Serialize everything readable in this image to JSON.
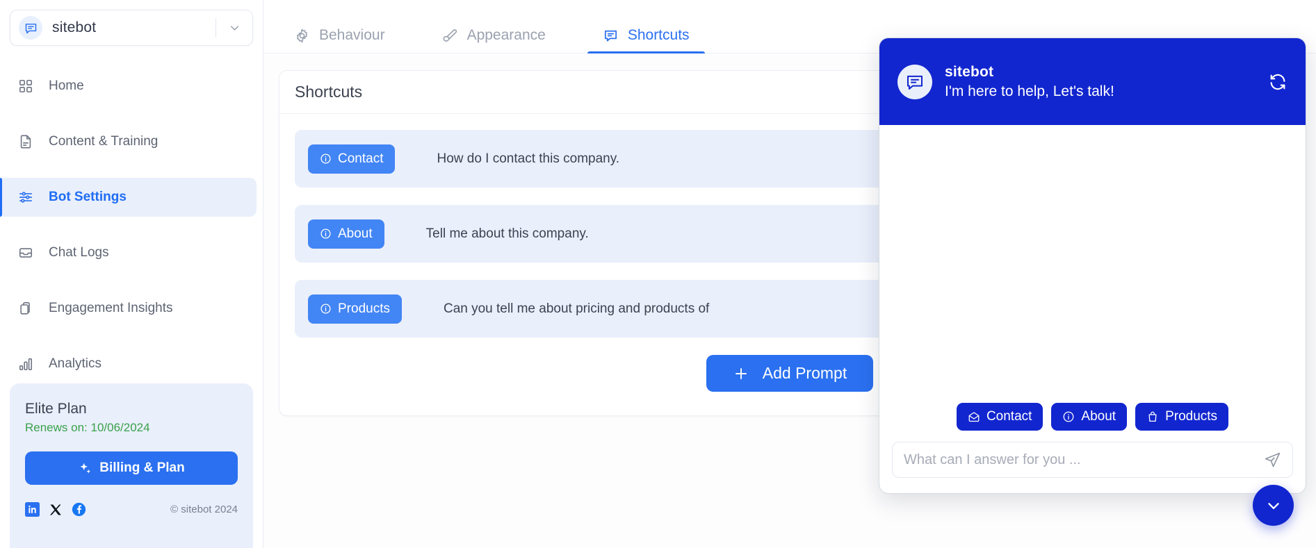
{
  "sidebar": {
    "bot_selector": {
      "name": "sitebot",
      "icon": "chat-bubble-icon",
      "caret": "chevron-down-icon"
    },
    "nav_items": [
      {
        "label": "Home",
        "icon": "grid-icon",
        "active": false
      },
      {
        "label": "Content & Training",
        "icon": "document-icon",
        "active": false
      },
      {
        "label": "Bot Settings",
        "icon": "sliders-icon",
        "active": true
      },
      {
        "label": "Chat Logs",
        "icon": "inbox-icon",
        "active": false
      },
      {
        "label": "Engagement Insights",
        "icon": "clipboard-icon",
        "active": false
      },
      {
        "label": "Analytics",
        "icon": "bar-chart-icon",
        "active": false
      }
    ],
    "plan": {
      "title": "Elite Plan",
      "renews": "Renews on: 10/06/2024",
      "renews_color": "#3aa14b",
      "billing_button": "Billing & Plan",
      "billing_icon": "sparkle-icon"
    },
    "footer": {
      "socials": [
        "linkedin-icon",
        "x-icon",
        "facebook-icon"
      ],
      "copyright": "© sitebot 2024"
    }
  },
  "main": {
    "tabs": [
      {
        "label": "Behaviour",
        "icon": "gear-icon",
        "active": false
      },
      {
        "label": "Appearance",
        "icon": "brush-icon",
        "active": false
      },
      {
        "label": "Shortcuts",
        "icon": "chat-square-icon",
        "active": true
      }
    ],
    "panel_title": "Shortcuts",
    "shortcuts": [
      {
        "chip": "Contact",
        "chip_icon": "info-icon",
        "text": "How do I contact this company.",
        "edit_icon": "pencil-icon",
        "delete_icon": "trash-icon"
      },
      {
        "chip": "About",
        "chip_icon": "info-icon",
        "text": "Tell me about this company.",
        "edit_icon": "pencil-icon",
        "delete_icon": "trash-icon"
      },
      {
        "chip": "Products",
        "chip_icon": "info-icon",
        "text": "Can you tell me about pricing and products of",
        "edit_icon": "pencil-icon",
        "delete_icon": "trash-icon"
      }
    ],
    "add_button": {
      "label": "Add Prompt",
      "icon": "plus-icon"
    }
  },
  "chat_widget": {
    "header": {
      "title": "sitebot",
      "subtitle": "I'm here to help, Let's talk!",
      "avatar_icon": "chat-bubble-icon",
      "refresh_icon": "refresh-icon"
    },
    "quick_replies": [
      {
        "label": "Contact",
        "icon": "envelope-open-icon"
      },
      {
        "label": "About",
        "icon": "info-icon"
      },
      {
        "label": "Products",
        "icon": "bag-icon"
      }
    ],
    "input": {
      "placeholder": "What can I answer for you ...",
      "value": "",
      "send_icon": "send-icon"
    },
    "fab_icon": "chevron-down-icon"
  },
  "colors": {
    "brand_blue": "#2a70f0",
    "widget_blue": "#1226cf",
    "chip_blue": "#4285f4",
    "row_bg": "#e9effb",
    "danger": "#e8443a",
    "green": "#3aa14b"
  }
}
